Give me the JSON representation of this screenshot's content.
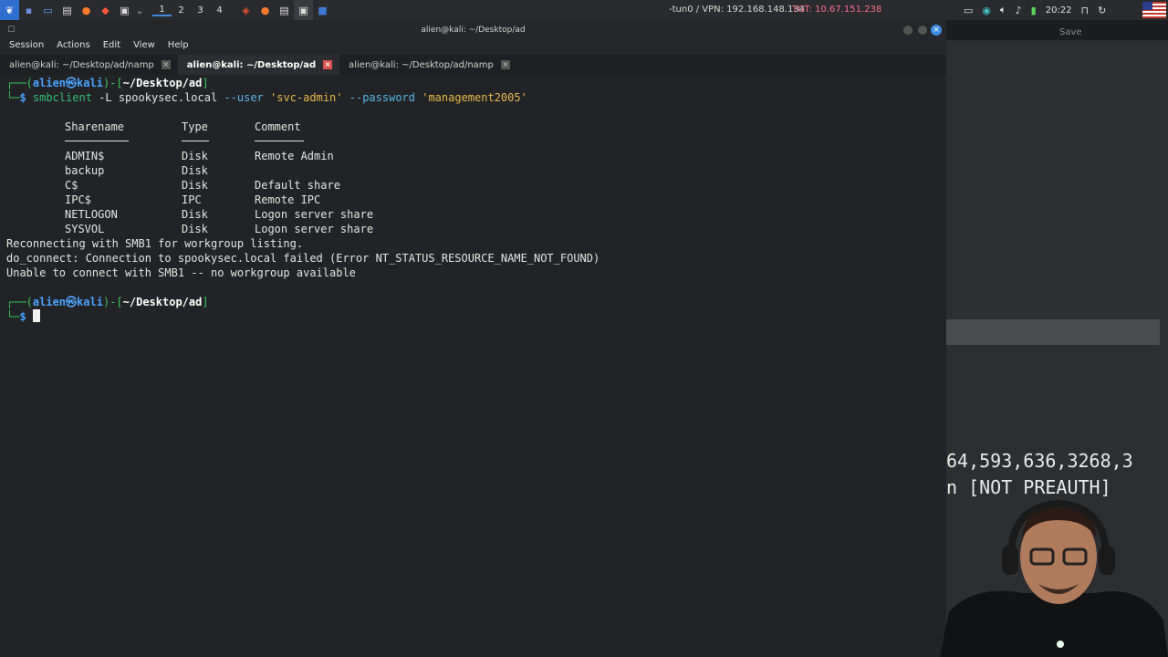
{
  "topbar": {
    "workspaces": [
      "1",
      "2",
      "3",
      "4"
    ],
    "active_workspace": 0,
    "vpn": "-tun0 / VPN: 192.168.148.134",
    "tgt": "TGT: 10.67.151.238",
    "clock": "20:22"
  },
  "window": {
    "title": "alien@kali: ~/Desktop/ad",
    "menu": [
      "Session",
      "Actions",
      "Edit",
      "View",
      "Help"
    ],
    "tabs": [
      {
        "label": "alien@kali: ~/Desktop/ad/namp"
      },
      {
        "label": "alien@kali: ~/Desktop/ad"
      },
      {
        "label": "alien@kali: ~/Desktop/ad/namp"
      }
    ]
  },
  "terminal": {
    "prompt_user": "alien",
    "prompt_at": "㉿",
    "prompt_host": "kali",
    "prompt_dir": "~/Desktop/ad",
    "cmd_name": "smbclient",
    "cmd_args1": " -L spookysec.local ",
    "cmd_flag_user": "--user",
    "cmd_user_val": "'svc-admin'",
    "cmd_flag_pass": "--password",
    "cmd_pass_val": "'management2005'",
    "headers": {
      "name": "Sharename",
      "type": "Type",
      "comment": "Comment"
    },
    "shares": [
      {
        "name": "ADMIN$",
        "type": "Disk",
        "comment": "Remote Admin"
      },
      {
        "name": "backup",
        "type": "Disk",
        "comment": ""
      },
      {
        "name": "C$",
        "type": "Disk",
        "comment": "Default share"
      },
      {
        "name": "IPC$",
        "type": "IPC",
        "comment": "Remote IPC"
      },
      {
        "name": "NETLOGON",
        "type": "Disk",
        "comment": "Logon server share"
      },
      {
        "name": "SYSVOL",
        "type": "Disk",
        "comment": "Logon server share"
      }
    ],
    "output": [
      "Reconnecting with SMB1 for workgroup listing.",
      "do_connect: Connection to spookysec.local failed (Error NT_STATUS_RESOURCE_NAME_NOT_FOUND)",
      "Unable to connect with SMB1 -- no workgroup available"
    ]
  },
  "right_panel": {
    "save_label": "Save",
    "overlay_line1": "64,593,636,3268,3",
    "overlay_line2": "n [NOT PREAUTH]"
  },
  "colors": {
    "accent": "#3b8be0",
    "prompt_green": "#34c759",
    "prompt_blue": "#4aa3ff"
  }
}
